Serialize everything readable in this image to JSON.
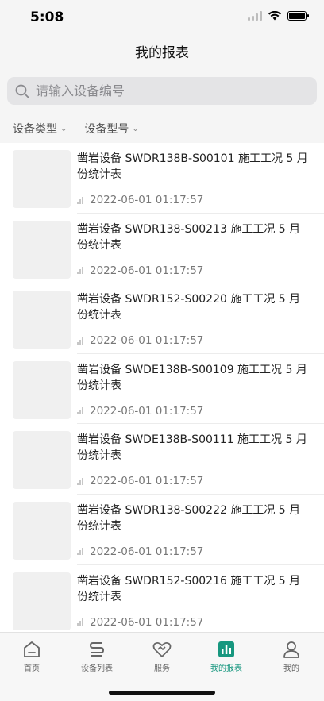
{
  "status": {
    "time": "5:08"
  },
  "header": {
    "title": "我的报表"
  },
  "search": {
    "placeholder": "请输入设备编号"
  },
  "filters": [
    {
      "label": "设备类型"
    },
    {
      "label": "设备型号"
    }
  ],
  "reports": [
    {
      "title": "凿岩设备 SWDR138B-S00101 施工工况 5 月份统计表",
      "date": "2022-06-01 01:17:57"
    },
    {
      "title": "凿岩设备 SWDR138-S00213 施工工况 5 月份统计表",
      "date": "2022-06-01 01:17:57"
    },
    {
      "title": "凿岩设备 SWDR152-S00220 施工工况 5 月份统计表",
      "date": "2022-06-01 01:17:57"
    },
    {
      "title": "凿岩设备 SWDE138B-S00109 施工工况 5 月份统计表",
      "date": "2022-06-01 01:17:57"
    },
    {
      "title": "凿岩设备 SWDE138B-S00111 施工工况 5 月份统计表",
      "date": "2022-06-01 01:17:57"
    },
    {
      "title": "凿岩设备 SWDR138-S00222 施工工况 5 月份统计表",
      "date": "2022-06-01 01:17:57"
    },
    {
      "title": "凿岩设备 SWDR152-S00216 施工工况 5 月份统计表",
      "date": "2022-06-01 01:17:57"
    }
  ],
  "tabs": [
    {
      "label": "首页",
      "icon": "home-icon"
    },
    {
      "label": "设备列表",
      "icon": "device-list-icon"
    },
    {
      "label": "服务",
      "icon": "service-icon"
    },
    {
      "label": "我的报表",
      "icon": "report-icon",
      "active": true
    },
    {
      "label": "我的",
      "icon": "profile-icon"
    }
  ],
  "colors": {
    "accent": "#17977f",
    "background": "#f5f5f5"
  }
}
